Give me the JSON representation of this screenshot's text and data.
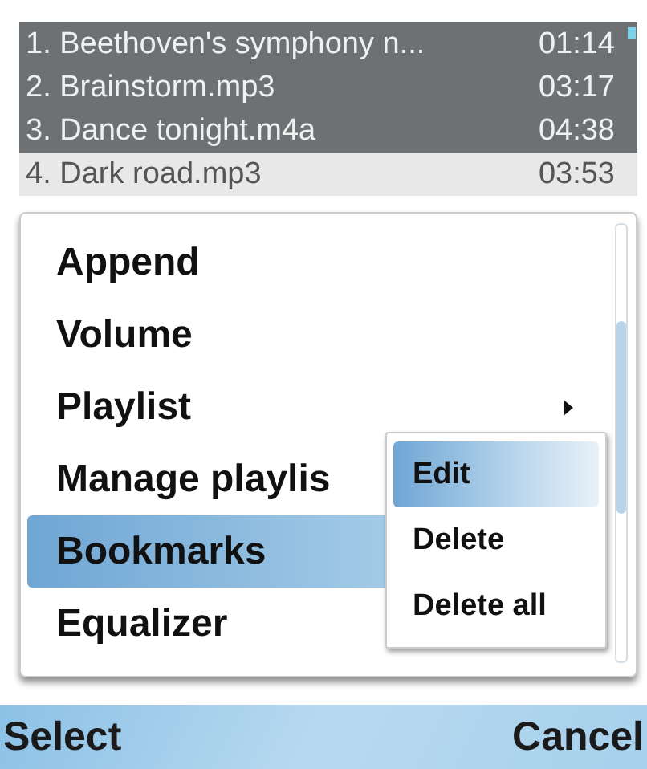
{
  "tracks": [
    {
      "title": "1. Beethoven's symphony n...",
      "duration": "01:14",
      "shaded": true
    },
    {
      "title": "2. Brainstorm.mp3",
      "duration": "03:17",
      "shaded": true
    },
    {
      "title": "3. Dance tonight.m4a",
      "duration": "04:38",
      "shaded": true
    },
    {
      "title": "4. Dark road.mp3",
      "duration": "03:53",
      "shaded": false
    }
  ],
  "menu": {
    "items": [
      {
        "label": "Append",
        "selected": false,
        "has_submenu": false
      },
      {
        "label": "Volume",
        "selected": false,
        "has_submenu": false
      },
      {
        "label": "Playlist",
        "selected": false,
        "has_submenu": true
      },
      {
        "label": "Manage playlis",
        "selected": false,
        "has_submenu": false
      },
      {
        "label": "Bookmarks",
        "selected": true,
        "has_submenu": false
      },
      {
        "label": "Equalizer",
        "selected": false,
        "has_submenu": false
      }
    ]
  },
  "submenu": {
    "items": [
      {
        "label": "Edit",
        "selected": true
      },
      {
        "label": "Delete",
        "selected": false
      },
      {
        "label": "Delete all",
        "selected": false
      }
    ]
  },
  "softkeys": {
    "left": "Select",
    "right": "Cancel"
  }
}
